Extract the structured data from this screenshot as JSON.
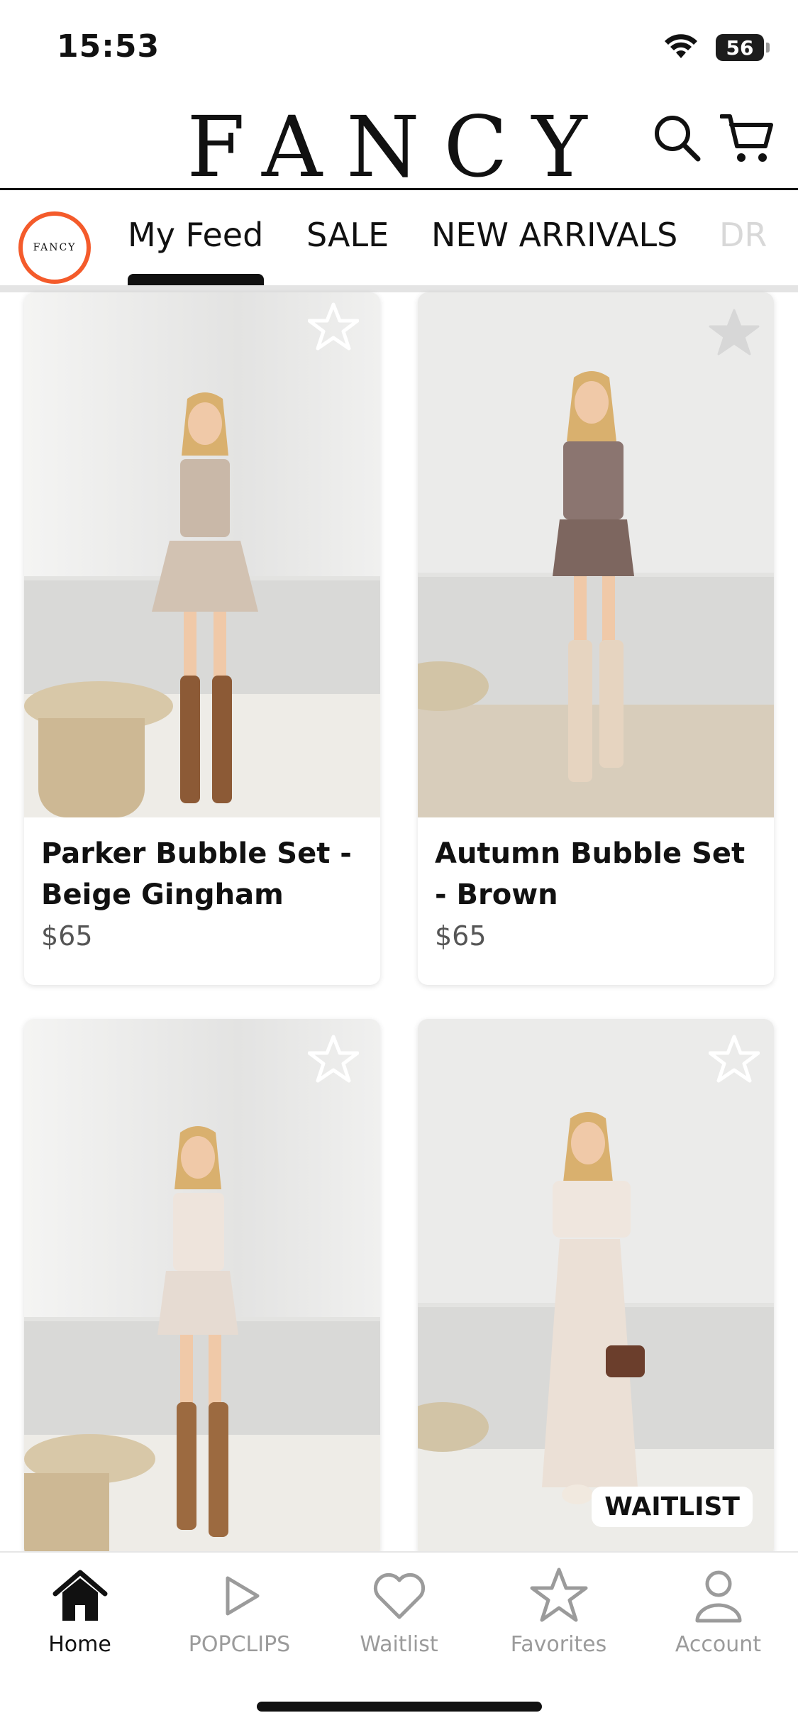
{
  "status_bar": {
    "time": "15:53",
    "battery": "56"
  },
  "header": {
    "logo": "FANCY"
  },
  "tabs": {
    "logo_text": "FANCY",
    "items": [
      {
        "label": "My Feed",
        "active": true
      },
      {
        "label": "SALE",
        "active": false
      },
      {
        "label": "NEW ARRIVALS",
        "active": false
      },
      {
        "label": "DR",
        "active": false
      }
    ]
  },
  "products": [
    {
      "name": "Parker Bubble Set - Beige Gingham",
      "price": "$65",
      "favorited": false
    },
    {
      "name": "Autumn Bubble Set - Brown",
      "price": "$65",
      "favorited": false
    },
    {
      "name": "",
      "price": "",
      "favorited": false
    },
    {
      "name": "",
      "price": "",
      "favorited": false,
      "badge": "WAITLIST"
    }
  ],
  "bottom_nav": [
    {
      "label": "Home",
      "icon": "home-icon",
      "active": true
    },
    {
      "label": "POPCLIPS",
      "icon": "play-icon",
      "active": false
    },
    {
      "label": "Waitlist",
      "icon": "heart-icon",
      "active": false
    },
    {
      "label": "Favorites",
      "icon": "star-icon",
      "active": false
    },
    {
      "label": "Account",
      "icon": "person-icon",
      "active": false
    }
  ],
  "colors": {
    "accent": "#f45b2b",
    "text": "#111111",
    "muted": "#9b9b9b"
  }
}
